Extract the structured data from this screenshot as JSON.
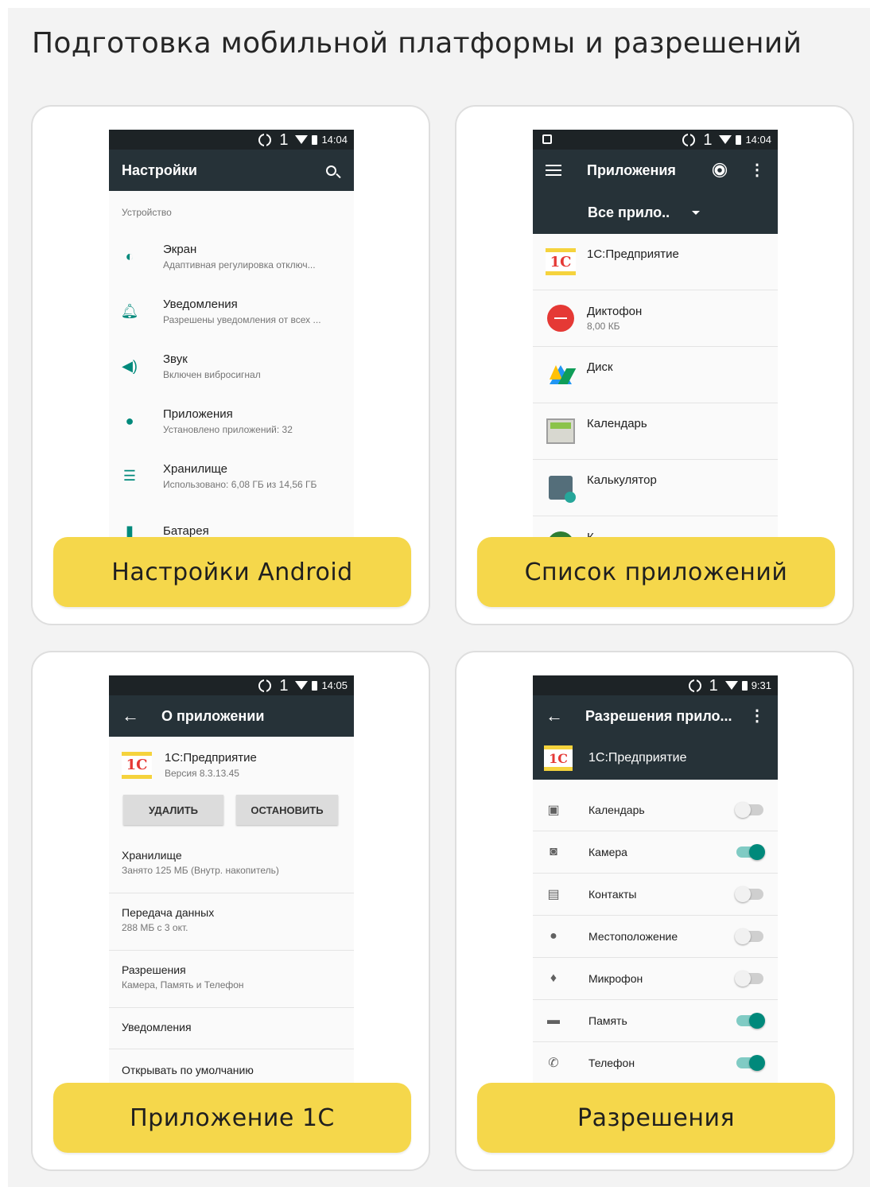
{
  "page": {
    "title": "Подготовка мобильной платформы и разрешений"
  },
  "cards": [
    {
      "caption": "Настройки Android",
      "status": {
        "sim": "1",
        "time": "14:04"
      },
      "appbar": {
        "title": "Настройки"
      },
      "section": "Устройство",
      "rows": [
        {
          "title": "Экран",
          "subtitle": "Адаптивная регулировка отключ..."
        },
        {
          "title": "Уведомления",
          "subtitle": "Разрешены уведомления от всех ..."
        },
        {
          "title": "Звук",
          "subtitle": "Включен вибросигнал"
        },
        {
          "title": "Приложения",
          "subtitle": "Установлено приложений: 32"
        },
        {
          "title": "Хранилище",
          "subtitle": "Использовано: 6,08 ГБ из 14,56 ГБ"
        },
        {
          "title": "Батарея",
          "subtitle": ""
        }
      ]
    },
    {
      "caption": "Список приложений",
      "status": {
        "sim": "1",
        "time": "14:04"
      },
      "appbar": {
        "title": "Приложения"
      },
      "filter": "Все прило..",
      "apps": [
        {
          "title": "1С:Предприятие",
          "subtitle": ""
        },
        {
          "title": "Диктофон",
          "subtitle": "8,00 КБ"
        },
        {
          "title": "Диск",
          "subtitle": ""
        },
        {
          "title": "Календарь",
          "subtitle": ""
        },
        {
          "title": "Калькулятор",
          "subtitle": ""
        },
        {
          "title": "К...",
          "subtitle": ""
        }
      ]
    },
    {
      "caption": "Приложение 1С",
      "status": {
        "sim": "1",
        "time": "14:05"
      },
      "appbar": {
        "title": "О приложении"
      },
      "app": {
        "name": "1С:Предприятие",
        "version": "Версия 8.3.13.45"
      },
      "buttons": {
        "delete": "УДАЛИТЬ",
        "stop": "ОСТАНОВИТЬ"
      },
      "rows": [
        {
          "title": "Хранилище",
          "subtitle": "Занято 125 МБ (Внутр. накопитель)"
        },
        {
          "title": "Передача данных",
          "subtitle": "288 МБ с 3 окт."
        },
        {
          "title": "Разрешения",
          "subtitle": "Камера, Память и Телефон"
        },
        {
          "title": "Уведомления",
          "subtitle": ""
        },
        {
          "title": "Открывать по умолчанию",
          "subtitle": ""
        }
      ]
    },
    {
      "caption": "Разрешения",
      "status": {
        "sim": "1",
        "time": "9:31"
      },
      "appbar": {
        "title": "Разрешения прило..."
      },
      "app": {
        "name": "1С:Предприятие"
      },
      "permissions": [
        {
          "label": "Календарь",
          "enabled": false,
          "icon": "calendar-icon"
        },
        {
          "label": "Камера",
          "enabled": true,
          "icon": "camera-icon"
        },
        {
          "label": "Контакты",
          "enabled": false,
          "icon": "contacts-icon"
        },
        {
          "label": "Местоположение",
          "enabled": false,
          "icon": "location-icon"
        },
        {
          "label": "Микрофон",
          "enabled": false,
          "icon": "microphone-icon"
        },
        {
          "label": "Память",
          "enabled": true,
          "icon": "folder-icon"
        },
        {
          "label": "Телефон",
          "enabled": true,
          "icon": "phone-icon"
        }
      ]
    }
  ],
  "colors": {
    "caption": "#f5d74b",
    "appbar": "#263238",
    "statusbar": "#1d2326",
    "accent": "#00897b"
  }
}
